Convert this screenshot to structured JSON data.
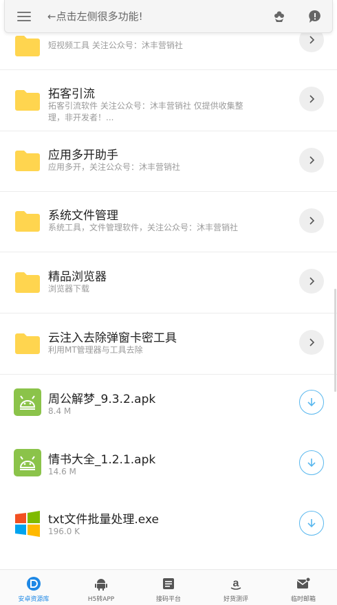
{
  "topbar": {
    "hint": "←点击左侧很多功能!"
  },
  "items": [
    {
      "title": "",
      "sub": "短视频工具 关注公众号：沐丰营销社",
      "type": "folder"
    },
    {
      "title": "拓客引流",
      "sub": "拓客引流软件 关注公众号：沐丰营销社 仅提供收集整理，非开发者！...",
      "type": "folder"
    },
    {
      "title": "应用多开助手",
      "sub": "应用多开，关注公众号：沐丰营销社",
      "type": "folder"
    },
    {
      "title": "系统文件管理",
      "sub": "系统工具，文件管理软件，关注公众号：沐丰营销社",
      "type": "folder"
    },
    {
      "title": "精品浏览器",
      "sub": "浏览器下载",
      "type": "folder"
    },
    {
      "title": "云注入去除弹窗卡密工具",
      "sub": "利用MT管理器与工具去除",
      "type": "folder"
    },
    {
      "title": "周公解梦_9.3.2.apk",
      "sub": "8.4 M",
      "type": "apk"
    },
    {
      "title": "情书大全_1.2.1.apk",
      "sub": "14.6 M",
      "type": "apk"
    },
    {
      "title": "txt文件批量处理.exe",
      "sub": "196.0 K",
      "type": "exe"
    }
  ],
  "bottom_nav": [
    {
      "label": "安卓资源库",
      "icon": "d-logo-icon",
      "active": true
    },
    {
      "label": "H5转APP",
      "icon": "android-icon",
      "active": false
    },
    {
      "label": "接码平台",
      "icon": "document-icon",
      "active": false
    },
    {
      "label": "好货测评",
      "icon": "amazon-icon",
      "active": false
    },
    {
      "label": "临时邮箱",
      "icon": "mail-icon",
      "active": false
    }
  ],
  "colors": {
    "accent": "#1e88e5",
    "folder": "#ffd54f",
    "download": "#58b7ee",
    "android": "#8bc34a"
  }
}
